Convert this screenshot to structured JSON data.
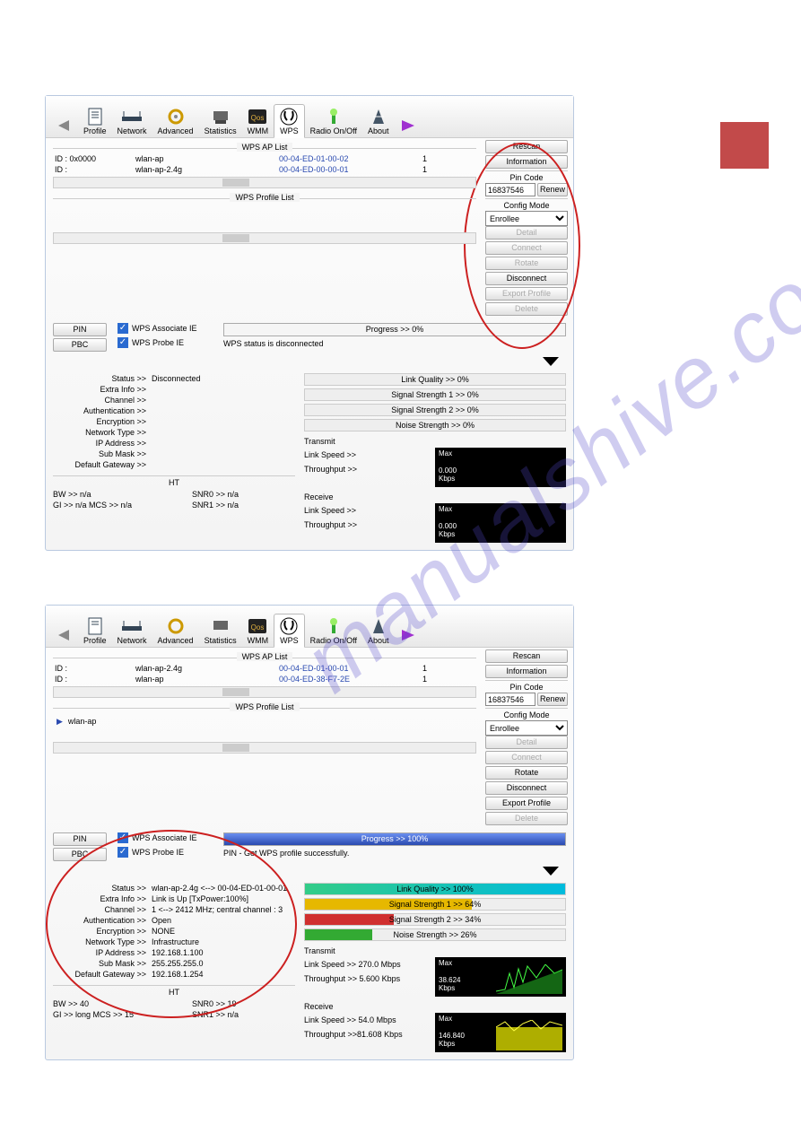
{
  "watermark": "manualshive.com",
  "tabs": [
    "Profile",
    "Network",
    "Advanced",
    "Statistics",
    "WMM",
    "WPS",
    "Radio On/Off",
    "About"
  ],
  "section": {
    "aplist": "WPS AP List",
    "profile": "WPS Profile List"
  },
  "side": {
    "rescan": "Rescan",
    "info": "Information",
    "pinlabel": "Pin Code",
    "pin": "16837546",
    "renew": "Renew",
    "cfglabel": "Config Mode",
    "cfg": "Enrollee",
    "detail": "Detail",
    "connect": "Connect",
    "rotate": "Rotate",
    "disconnect": "Disconnect",
    "export": "Export Profile",
    "delete": "Delete"
  },
  "pinbtn": "PIN",
  "pbcbtn": "PBC",
  "assoc": "WPS Associate IE",
  "probe": "WPS Probe IE",
  "shot1": {
    "ap": [
      {
        "id": "ID : 0x0000",
        "ssid": "wlan-ap",
        "mac": "00-04-ED-01-00-02",
        "ch": "1"
      },
      {
        "id": "ID :",
        "ssid": "wlan-ap-2.4g",
        "mac": "00-04-ED-00-00-01",
        "ch": "1"
      }
    ],
    "progress": "Progress >> 0%",
    "pstatus": "WPS status is disconnected",
    "status": {
      "Status >>": "Disconnected",
      "Extra Info >>": "",
      "Channel >>": "",
      "Authentication >>": "",
      "Encryption >>": "",
      "Network Type >>": "",
      "IP Address >>": "",
      "Sub Mask >>": "",
      "Default Gateway >>": ""
    },
    "ht": {
      "bw": "BW >> n/a",
      "snr0": "SNR0 >>   n/a",
      "gi": "GI >> n/a        MCS >>   n/a",
      "snr1": "SNR1 >>   n/a"
    },
    "q": [
      "Link Quality >> 0%",
      "Signal Strength 1 >> 0%",
      "Signal Strength 2 >> 0%",
      "Noise Strength >> 0%"
    ],
    "tx": {
      "title": "Transmit",
      "ls": "Link Speed >>",
      "tp": "Throughput >>",
      "max": "Max",
      "v1": "0.000",
      "v2": "Kbps"
    },
    "rx": {
      "title": "Receive",
      "ls": "Link Speed >>",
      "tp": "Throughput >>",
      "max": "Max",
      "v1": "0.000",
      "v2": "Kbps"
    }
  },
  "shot2": {
    "ap": [
      {
        "id": "ID :",
        "ssid": "wlan-ap-2.4g",
        "mac": "00-04-ED-01-00-01",
        "ch": "1"
      },
      {
        "id": "ID :",
        "ssid": "wlan-ap",
        "mac": "00-04-ED-38-F7-2E",
        "ch": "1"
      }
    ],
    "profile": "wlan-ap",
    "progress": "Progress >> 100%",
    "pstatus": "PIN - Get WPS profile successfully.",
    "status": {
      "Status >>": "wlan-ap-2.4g   <--> 00-04-ED-01-00-01",
      "Extra Info >>": "Link is Up [TxPower:100%]",
      "Channel >>": "1 <--> 2412 MHz; central channel : 3",
      "Authentication >>": "Open",
      "Encryption >>": "NONE",
      "Network Type >>": "Infrastructure",
      "IP Address >>": "192.168.1.100",
      "Sub Mask >>": "255.255.255.0",
      "Default Gateway >>": "192.168.1.254"
    },
    "ht": {
      "bw": "BW >> 40",
      "snr0": "SNR0 >>   19",
      "gi": "GI >> long        MCS >>   15",
      "snr1": "SNR1 >>   n/a"
    },
    "q": [
      {
        "t": "Link Quality >> 100%",
        "w": 100,
        "c": "linear-gradient(90deg,#3c8,#0bd)"
      },
      {
        "t": "Signal Strength 1 >> 64%",
        "w": 64,
        "c": "#e6b800"
      },
      {
        "t": "Signal Strength 2 >> 34%",
        "w": 34,
        "c": "#d03030"
      },
      {
        "t": "Noise Strength >> 26%",
        "w": 26,
        "c": "#3a3"
      }
    ],
    "tx": {
      "title": "Transmit",
      "ls": "Link Speed >> 270.0 Mbps",
      "tp": "Throughput >> 5.600 Kbps",
      "max": "Max",
      "v1": "38.624",
      "v2": "Kbps",
      "spark": "green"
    },
    "rx": {
      "title": "Receive",
      "ls": "Link Speed >> 54.0 Mbps",
      "tp": "Throughput >>81.608 Kbps",
      "max": "Max",
      "v1": "146.840",
      "v2": "Kbps",
      "spark": "yellow"
    }
  }
}
